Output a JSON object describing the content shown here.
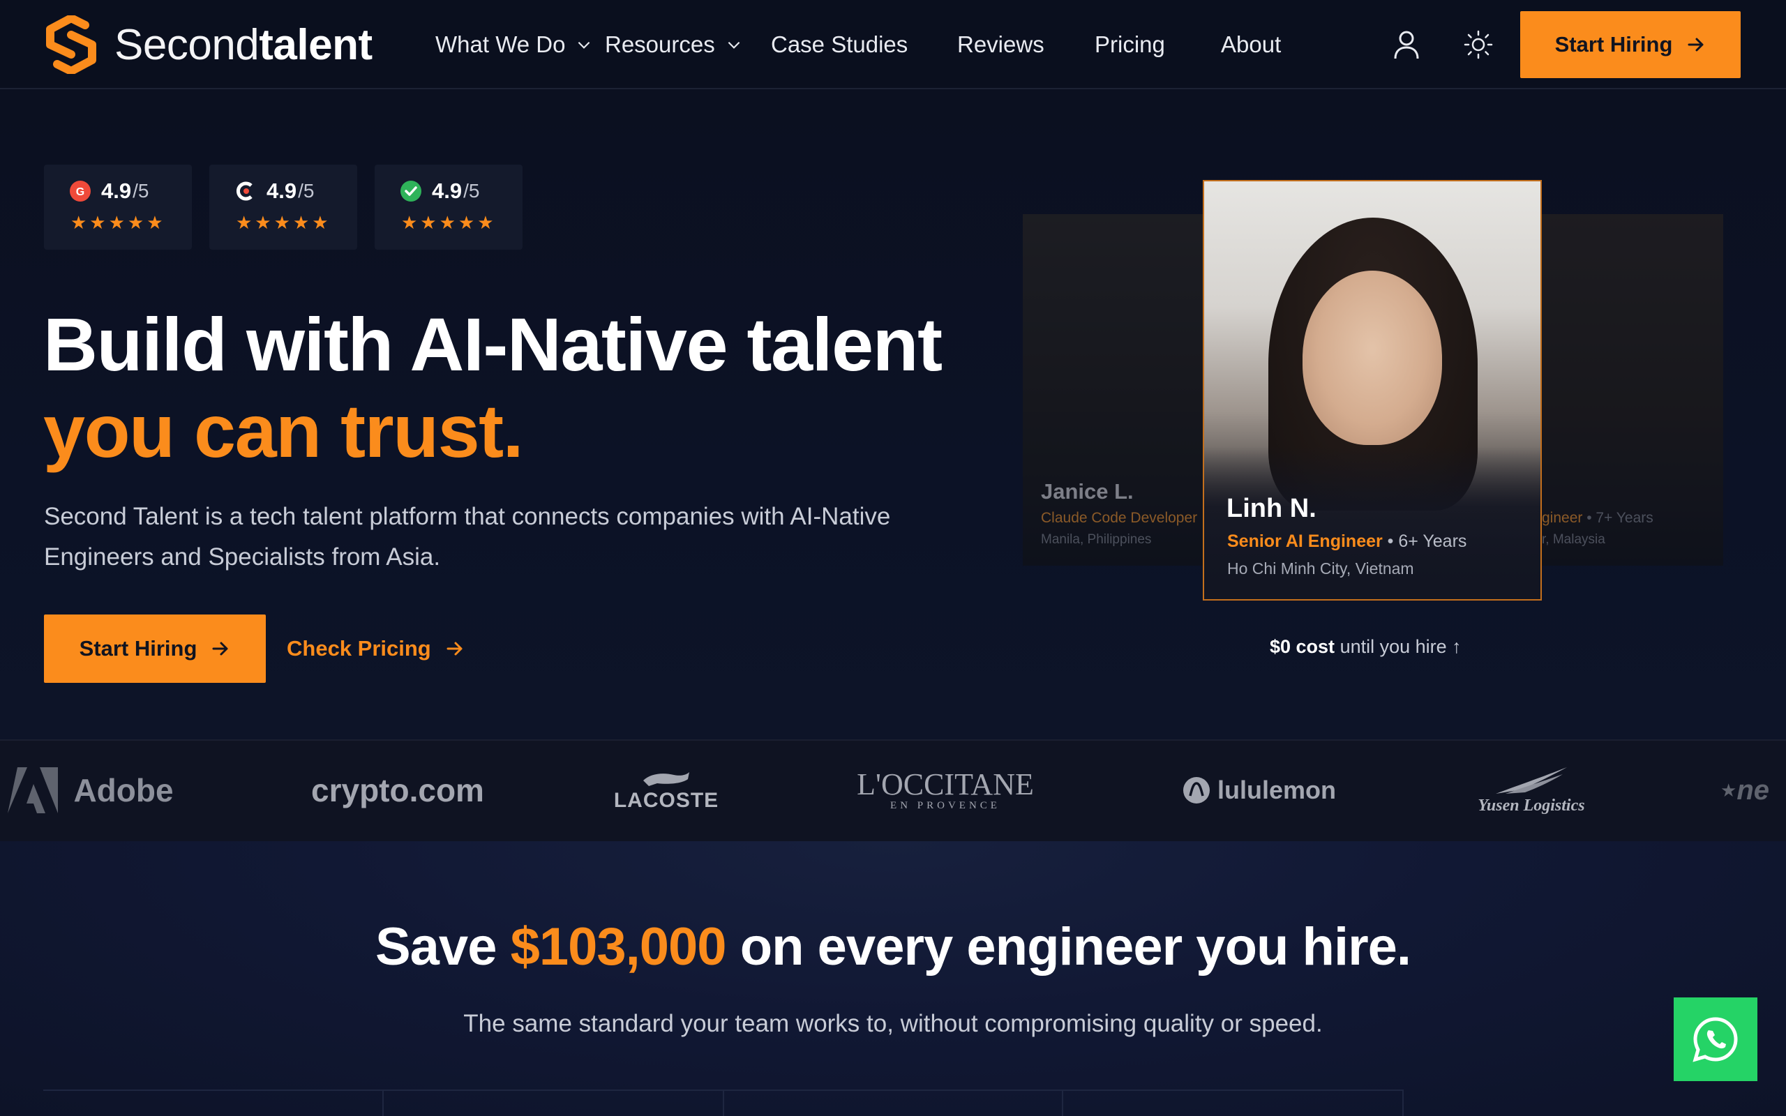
{
  "brand": {
    "name_light": "Second",
    "name_bold": "talent",
    "accent": "#fb8c1c"
  },
  "nav": {
    "items": [
      {
        "label": "What We Do",
        "has_dropdown": true
      },
      {
        "label": "Resources",
        "has_dropdown": true
      },
      {
        "label": "Case Studies",
        "has_dropdown": false
      },
      {
        "label": "Reviews",
        "has_dropdown": false
      },
      {
        "label": "Pricing",
        "has_dropdown": false
      },
      {
        "label": "About",
        "has_dropdown": false
      }
    ],
    "account_icon": "user-icon",
    "theme_icon": "sun-icon",
    "cta_label": "Start Hiring"
  },
  "ratings": [
    {
      "icon": "g2-icon",
      "score": "4.9",
      "max": "/5",
      "stars": "★★★★★"
    },
    {
      "icon": "clutch-icon",
      "score": "4.9",
      "max": "/5",
      "stars": "★★★★★"
    },
    {
      "icon": "verified-check-icon",
      "score": "4.9",
      "max": "/5",
      "stars": "★★★★★"
    }
  ],
  "hero": {
    "headline_line1": "Build with AI-Native talent",
    "headline_line2": "you can trust.",
    "subtext": "Second Talent is a tech talent platform that connects companies with AI-Native Engineers and Specialists from Asia.",
    "primary_cta": "Start Hiring",
    "secondary_cta": "Check Pricing"
  },
  "talent_cards": {
    "left": {
      "name": "Janice L.",
      "role": "Claude Code Developer",
      "location": "Manila, Philippines"
    },
    "main": {
      "name": "Linh N.",
      "role": "Senior AI Engineer",
      "years": " • 6+ Years",
      "location": "Ho Chi Minh City, Vietnam"
    },
    "right": {
      "role": "gineer",
      "years": " • 7+ Years",
      "location": "r, Malaysia"
    }
  },
  "cost_note": {
    "bold": "$0 cost",
    "rest": " until you hire ↑"
  },
  "client_logos": [
    "Adobe",
    "crypto.com",
    "LACOSTE",
    "L'OCCITANE",
    "EN PROVENCE",
    "lululemon",
    "Yusen Logistics",
    "ne"
  ],
  "save_section": {
    "title_pre": "Save ",
    "title_amount": "$103,000",
    "title_post": " on every engineer you hire.",
    "subtitle": "The same standard your team works to, without compromising quality or speed."
  },
  "chat_widget": {
    "icon": "whatsapp-icon",
    "color": "#25d366"
  }
}
